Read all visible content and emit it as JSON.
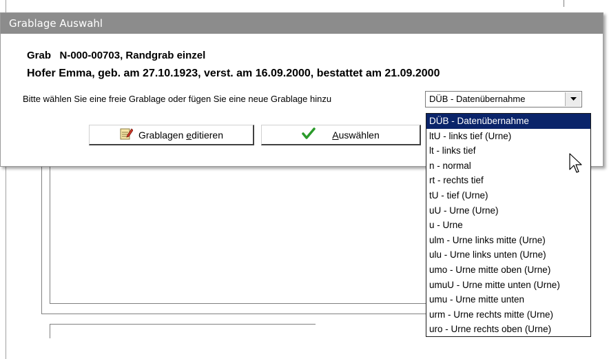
{
  "dialog": {
    "title": "Grablage Auswahl",
    "grave_line": "Grab   N-000-00703, Randgrab einzel",
    "person_line": "Hofer Emma, geb. am 27.10.1923, verst. am 16.09.2000, bestattet am 21.09.2000",
    "prompt": "Bitte wählen Sie eine freie Grablage oder fügen Sie eine neue Grablage hinzu",
    "combo_value": "DÜB - Datenübernahme",
    "buttons": {
      "edit_label_pre": "Grablagen ",
      "edit_label_mn": "e",
      "edit_label_post": "ditieren",
      "select_label_mn": "A",
      "select_label_post": "uswählen"
    }
  },
  "dropdown": {
    "selected_index": 0,
    "options": [
      "DÜB - Datenübernahme",
      "ltU - links tief (Urne)",
      "lt - links tief",
      "n - normal",
      "rt - rechts tief",
      "tU - tief (Urne)",
      "uU - Urne (Urne)",
      "u - Urne",
      "ulm - Urne links mitte (Urne)",
      "ulu - Urne links unten (Urne)",
      "umo - Urne mitte oben (Urne)",
      "umuU - Urne mitte unten (Urne)",
      "umu - Urne mitte unten",
      "urm - Urne rechts mitte (Urne)",
      "uro - Urne rechts oben (Urne)"
    ]
  },
  "colors": {
    "titlebar": "#8c8c8c",
    "selection": "#0a246a",
    "check_green": "#2a9a2a"
  },
  "icons": {
    "edit": "edit-notepad-icon",
    "select": "checkmark-icon",
    "combo": "dropdown-arrow-icon",
    "cursor": "mouse-pointer-icon"
  }
}
